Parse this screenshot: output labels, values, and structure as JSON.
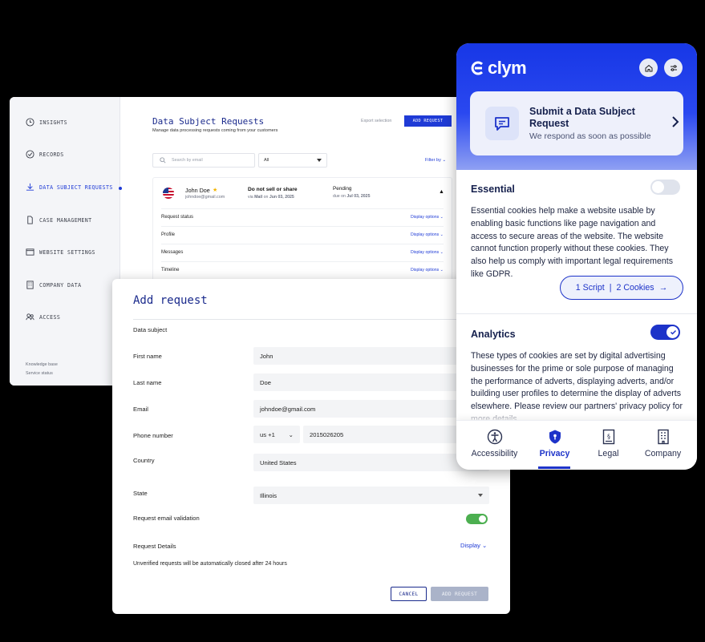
{
  "dashboard": {
    "sidebar": {
      "items": [
        {
          "label": "INSIGHTS"
        },
        {
          "label": "RECORDS"
        },
        {
          "label": "DATA SUBJECT REQUESTS"
        },
        {
          "label": "CASE MANAGEMENT"
        },
        {
          "label": "WEBSITE SETTINGS"
        },
        {
          "label": "COMPANY DATA"
        },
        {
          "label": "ACCESS"
        }
      ],
      "active_item": "DATA SUBJECT REQUESTS",
      "footer_links": [
        "Knowledge base",
        "Service status"
      ]
    },
    "title": "Data Subject Requests",
    "subtitle": "Manage data processing requests coming from your customers",
    "export_selection": "Export selection",
    "add_request_button": "ADD REQUEST",
    "search_placeholder": "Search by email",
    "filter_select": "All",
    "filter_by": "Filter by",
    "request": {
      "name": "John Doe",
      "email": "johndoe@gmail.com",
      "type": "Do not sell or share",
      "via_prefix": "via",
      "via": "Mail",
      "on_prefix": "on",
      "date": "Jun 03, 2025",
      "status": "Pending",
      "due_prefix": "due on",
      "due_date": "Jul 03, 2025",
      "rows": [
        {
          "label": "Request status",
          "option": "Display options"
        },
        {
          "label": "Profile",
          "option": "Display options"
        },
        {
          "label": "Messages",
          "option": "Display options"
        },
        {
          "label": "Timeline",
          "option": "Display options"
        }
      ]
    }
  },
  "modal": {
    "title": "Add request",
    "section": "Data subject",
    "fields": {
      "first_name": {
        "label": "First name",
        "value": "John"
      },
      "last_name": {
        "label": "Last name",
        "value": "Doe"
      },
      "email": {
        "label": "Email",
        "value": "johndoe@gmail.com"
      },
      "phone": {
        "label": "Phone number",
        "country_code": "us",
        "dial": "+1",
        "value": "2015026205"
      },
      "country": {
        "label": "Country",
        "value": "United States"
      },
      "state": {
        "label": "State",
        "value": "Illinois"
      }
    },
    "email_validation": {
      "label": "Request email validation",
      "enabled": true
    },
    "request_details": {
      "label": "Request Details",
      "toggle": "Display"
    },
    "note": "Unverified requests will be automatically closed after 24 hours",
    "cancel_button": "CANCEL",
    "add_button": "ADD REQUEST"
  },
  "clym": {
    "logo": "clym",
    "submit_card": {
      "title": "Submit a Data Subject Request",
      "subtitle": "We respond as soon as possible"
    },
    "essential": {
      "title": "Essential",
      "enabled": false,
      "body": "Essential cookies help make a website usable by enabling basic functions like page navigation and access to secure areas of the website. The website cannot function properly without these cookies. They also help us comply with important legal requirements like GDPR.",
      "scripts_label": "1 Script",
      "cookies_label": "2 Cookies",
      "separator": "|"
    },
    "analytics": {
      "title": "Analytics",
      "enabled": true,
      "body": "These types of cookies are set by digital advertising businesses for the prime or sole purpose of managing the performance of adverts, displaying adverts, and/or building user profiles to determine the display of adverts elsewhere. Please review our partners' privacy policy for more details."
    },
    "tabs": [
      {
        "label": "Accessibility",
        "icon": "accessibility-icon"
      },
      {
        "label": "Privacy",
        "icon": "shield-icon"
      },
      {
        "label": "Legal",
        "icon": "document-icon"
      },
      {
        "label": "Company",
        "icon": "building-icon"
      }
    ],
    "active_tab": "Privacy",
    "colors": {
      "brand": "#1f3bd6",
      "accent": "#1d33c9",
      "toggle_on": "#4caf50"
    }
  }
}
